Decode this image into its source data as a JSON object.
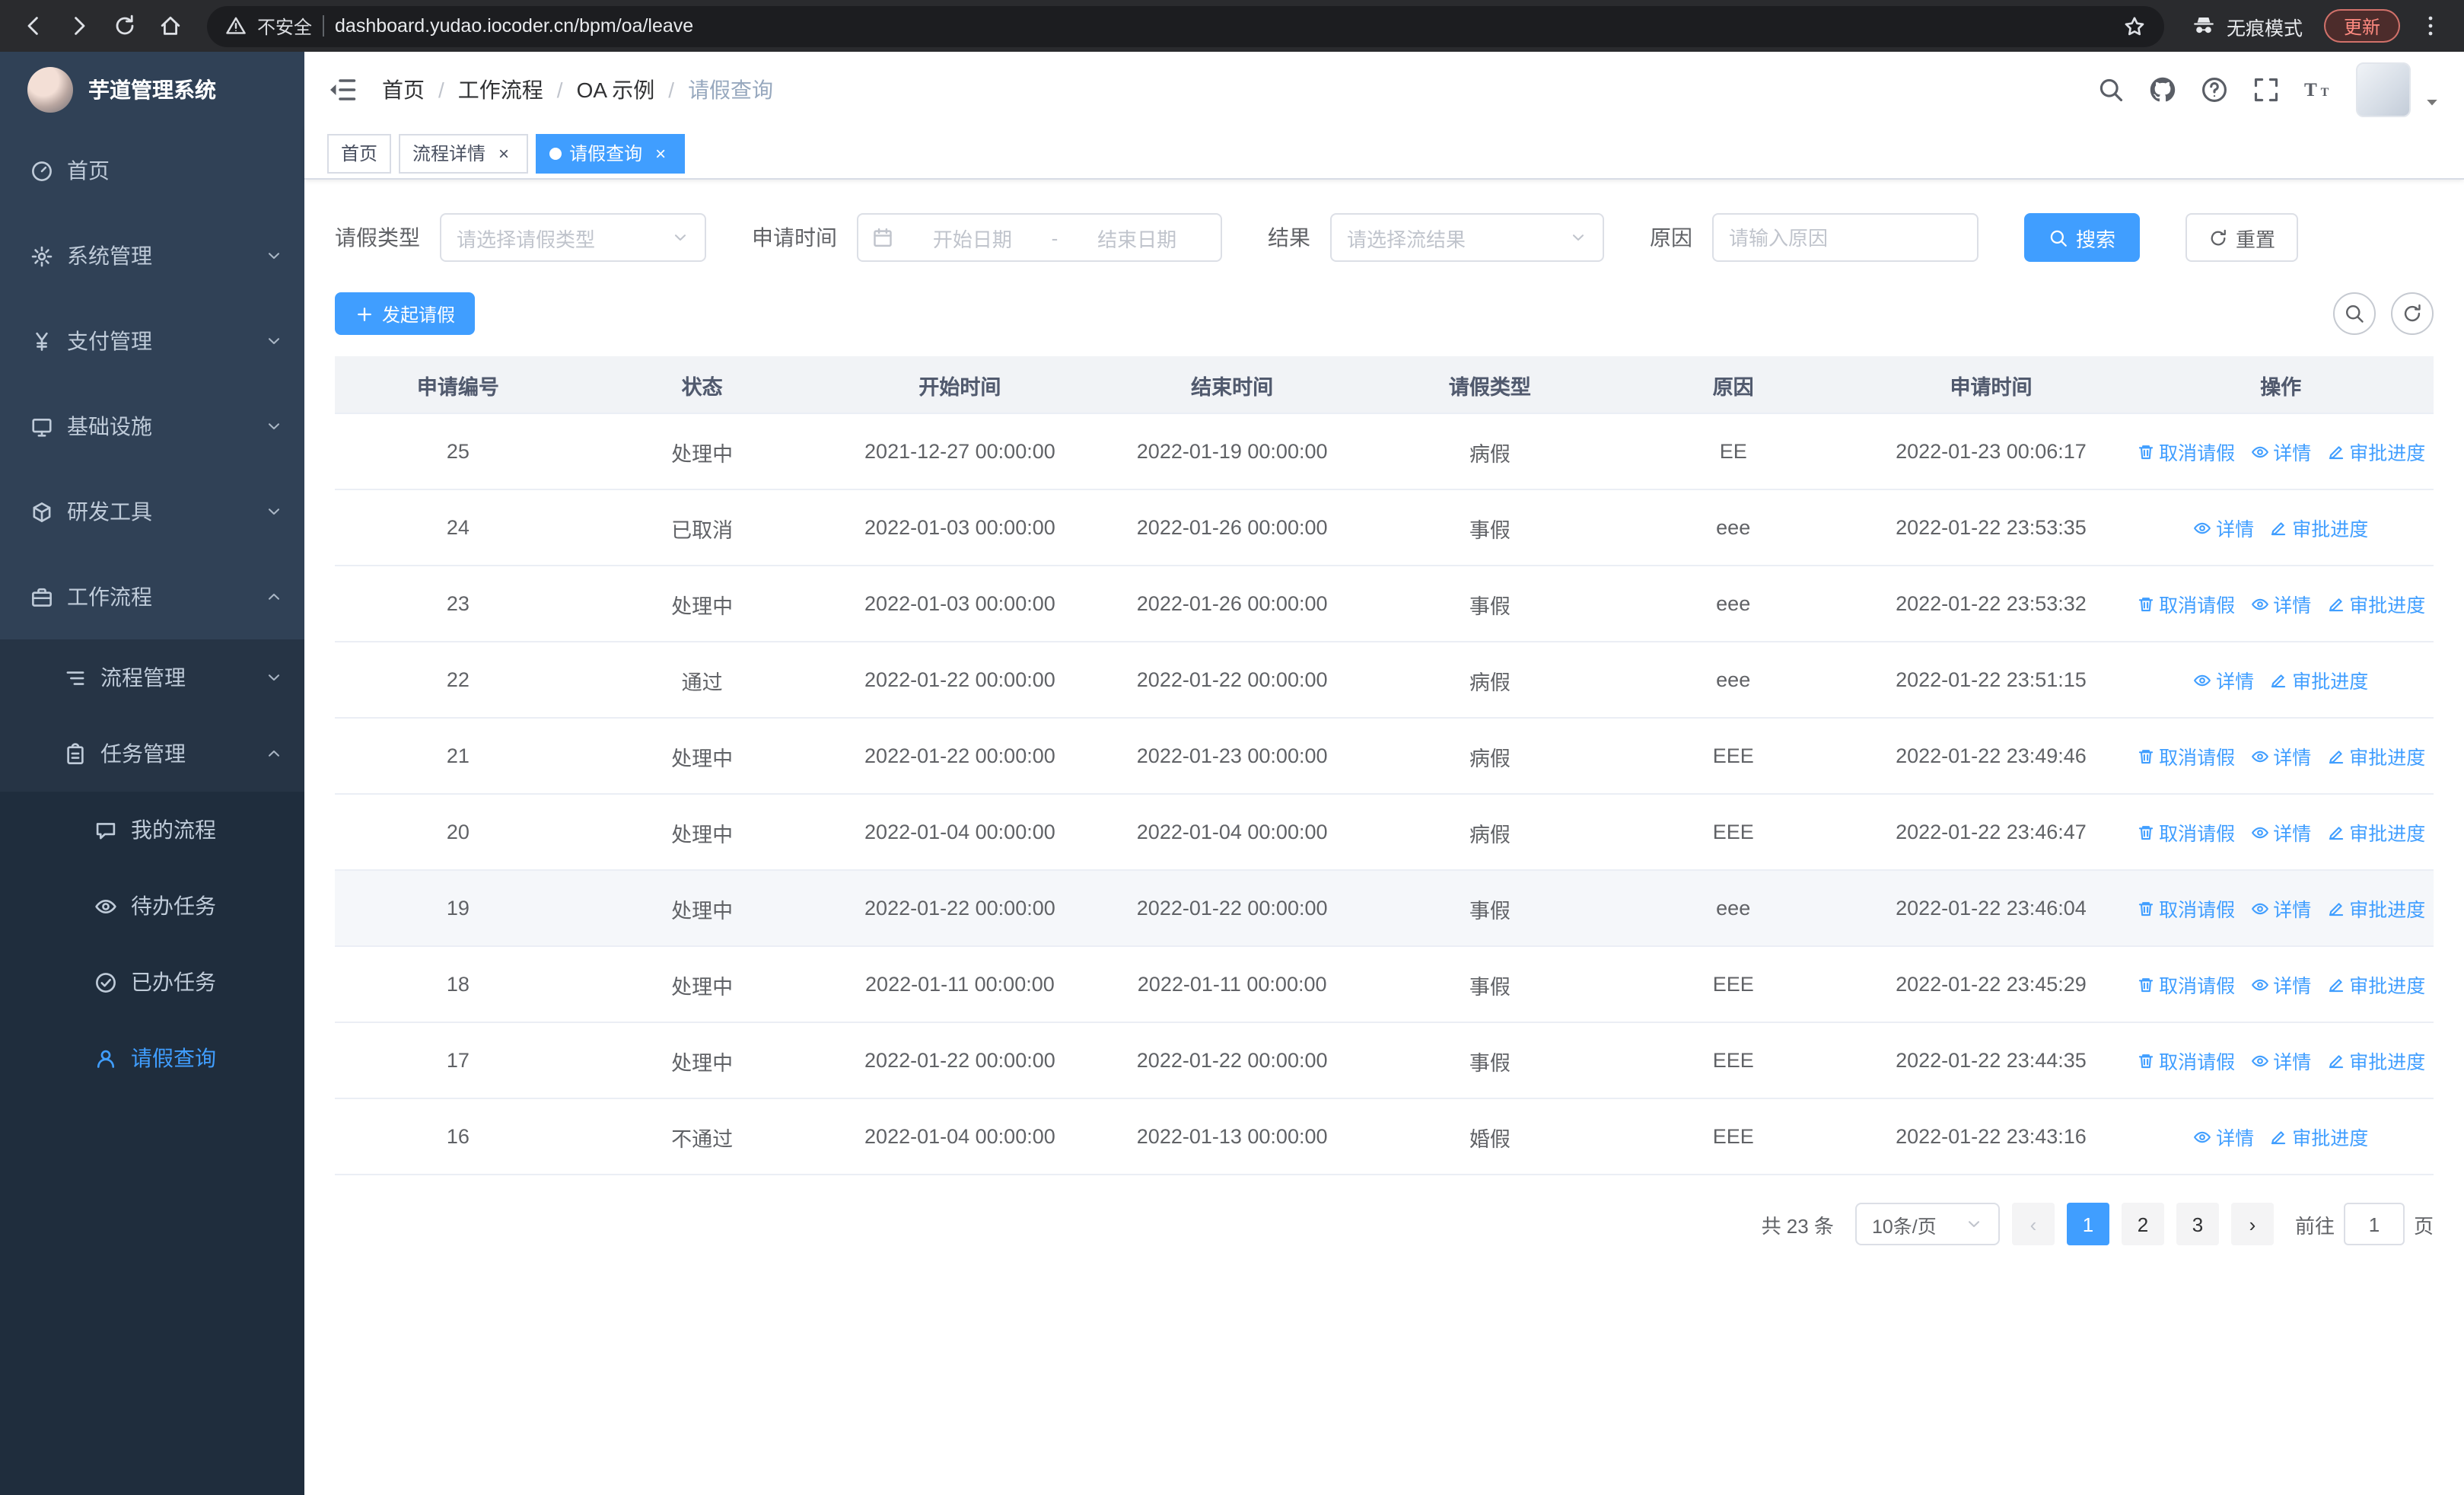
{
  "colors": {
    "accent": "#409eff"
  },
  "browser": {
    "security_label": "不安全",
    "url": "dashboard.yudao.iocoder.cn/bpm/oa/leave",
    "incognito_label": "无痕模式",
    "update_label": "更新"
  },
  "sidebar": {
    "logo_title": "芋道管理系统",
    "items": [
      {
        "key": "home",
        "label": "首页",
        "icon": "dashboard-icon",
        "level": 1,
        "expandable": false,
        "expanded": false,
        "active": false
      },
      {
        "key": "system-management",
        "label": "系统管理",
        "icon": "gear-icon",
        "level": 1,
        "expandable": true,
        "expanded": false,
        "active": false
      },
      {
        "key": "payment-management",
        "label": "支付管理",
        "icon": "yen-icon",
        "level": 1,
        "expandable": true,
        "expanded": false,
        "active": false
      },
      {
        "key": "infrastructure",
        "label": "基础设施",
        "icon": "monitor-icon",
        "level": 1,
        "expandable": true,
        "expanded": false,
        "active": false
      },
      {
        "key": "dev-tools",
        "label": "研发工具",
        "icon": "cube-icon",
        "level": 1,
        "expandable": true,
        "expanded": false,
        "active": false
      },
      {
        "key": "workflow",
        "label": "工作流程",
        "icon": "briefcase-icon",
        "level": 1,
        "expandable": true,
        "expanded": true,
        "active": false
      },
      {
        "key": "process-management",
        "label": "流程管理",
        "icon": "list-icon",
        "level": 2,
        "expandable": true,
        "expanded": false,
        "active": false
      },
      {
        "key": "task-management",
        "label": "任务管理",
        "icon": "clipboard-icon",
        "level": 2,
        "expandable": true,
        "expanded": true,
        "active": false
      },
      {
        "key": "my-process",
        "label": "我的流程",
        "icon": "chat-icon",
        "level": 3,
        "expandable": false,
        "expanded": false,
        "active": false
      },
      {
        "key": "todo-tasks",
        "label": "待办任务",
        "icon": "eye-icon",
        "level": 3,
        "expandable": false,
        "expanded": false,
        "active": false
      },
      {
        "key": "done-tasks",
        "label": "已办任务",
        "icon": "check-icon",
        "level": 3,
        "expandable": false,
        "expanded": false,
        "active": false
      },
      {
        "key": "leave-query",
        "label": "请假查询",
        "icon": "user-icon",
        "level": 3,
        "expandable": false,
        "expanded": false,
        "active": true
      }
    ]
  },
  "navbar": {
    "breadcrumb": [
      "首页",
      "工作流程",
      "OA 示例",
      "请假查询"
    ]
  },
  "tabs": [
    {
      "key": "home",
      "label": "首页",
      "closable": false,
      "active": false
    },
    {
      "key": "process-detail",
      "label": "流程详情",
      "closable": true,
      "active": false
    },
    {
      "key": "leave-query",
      "label": "请假查询",
      "closable": true,
      "active": true
    }
  ],
  "filters": {
    "leave_type_label": "请假类型",
    "leave_type_placeholder": "请选择请假类型",
    "apply_time_label": "申请时间",
    "start_date_placeholder": "开始日期",
    "range_separator": "-",
    "end_date_placeholder": "结束日期",
    "result_label": "结果",
    "result_placeholder": "请选择流结果",
    "reason_label": "原因",
    "reason_placeholder": "请输入原因",
    "search_label": "搜索",
    "reset_label": "重置"
  },
  "toolbar": {
    "create_label": "发起请假"
  },
  "table": {
    "columns": [
      "申请编号",
      "状态",
      "开始时间",
      "结束时间",
      "请假类型",
      "原因",
      "申请时间",
      "操作"
    ],
    "action_labels": {
      "cancel": "取消请假",
      "detail": "详情",
      "progress": "审批进度"
    },
    "rows": [
      {
        "id": "25",
        "status": "处理中",
        "start_time": "2021-12-27 00:00:00",
        "end_time": "2022-01-19 00:00:00",
        "leave_type": "病假",
        "reason": "EE",
        "apply_time": "2022-01-23 00:06:17",
        "cancellable": true,
        "hovered": false
      },
      {
        "id": "24",
        "status": "已取消",
        "start_time": "2022-01-03 00:00:00",
        "end_time": "2022-01-26 00:00:00",
        "leave_type": "事假",
        "reason": "eee",
        "apply_time": "2022-01-22 23:53:35",
        "cancellable": false,
        "hovered": false
      },
      {
        "id": "23",
        "status": "处理中",
        "start_time": "2022-01-03 00:00:00",
        "end_time": "2022-01-26 00:00:00",
        "leave_type": "事假",
        "reason": "eee",
        "apply_time": "2022-01-22 23:53:32",
        "cancellable": true,
        "hovered": false
      },
      {
        "id": "22",
        "status": "通过",
        "start_time": "2022-01-22 00:00:00",
        "end_time": "2022-01-22 00:00:00",
        "leave_type": "病假",
        "reason": "eee",
        "apply_time": "2022-01-22 23:51:15",
        "cancellable": false,
        "hovered": false
      },
      {
        "id": "21",
        "status": "处理中",
        "start_time": "2022-01-22 00:00:00",
        "end_time": "2022-01-23 00:00:00",
        "leave_type": "病假",
        "reason": "EEE",
        "apply_time": "2022-01-22 23:49:46",
        "cancellable": true,
        "hovered": false
      },
      {
        "id": "20",
        "status": "处理中",
        "start_time": "2022-01-04 00:00:00",
        "end_time": "2022-01-04 00:00:00",
        "leave_type": "病假",
        "reason": "EEE",
        "apply_time": "2022-01-22 23:46:47",
        "cancellable": true,
        "hovered": false
      },
      {
        "id": "19",
        "status": "处理中",
        "start_time": "2022-01-22 00:00:00",
        "end_time": "2022-01-22 00:00:00",
        "leave_type": "事假",
        "reason": "eee",
        "apply_time": "2022-01-22 23:46:04",
        "cancellable": true,
        "hovered": true
      },
      {
        "id": "18",
        "status": "处理中",
        "start_time": "2022-01-11 00:00:00",
        "end_time": "2022-01-11 00:00:00",
        "leave_type": "事假",
        "reason": "EEE",
        "apply_time": "2022-01-22 23:45:29",
        "cancellable": true,
        "hovered": false
      },
      {
        "id": "17",
        "status": "处理中",
        "start_time": "2022-01-22 00:00:00",
        "end_time": "2022-01-22 00:00:00",
        "leave_type": "事假",
        "reason": "EEE",
        "apply_time": "2022-01-22 23:44:35",
        "cancellable": true,
        "hovered": false
      },
      {
        "id": "16",
        "status": "不通过",
        "start_time": "2022-01-04 00:00:00",
        "end_time": "2022-01-13 00:00:00",
        "leave_type": "婚假",
        "reason": "EEE",
        "apply_time": "2022-01-22 23:43:16",
        "cancellable": false,
        "hovered": false
      }
    ]
  },
  "pagination": {
    "total_label": "共 23 条",
    "page_size_label": "10条/页",
    "pages": [
      "1",
      "2",
      "3"
    ],
    "active_page": "1",
    "prev_symbol": "‹",
    "next_symbol": "›",
    "jump_prefix": "前往",
    "jump_value": "1",
    "jump_suffix": "页"
  }
}
